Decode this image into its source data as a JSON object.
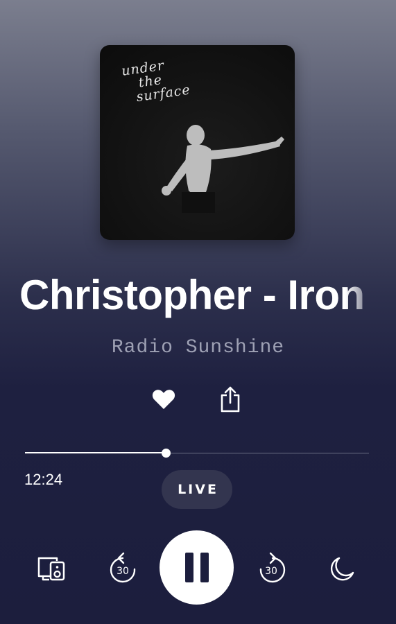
{
  "artwork": {
    "caption_line1": "under",
    "caption_line2": "the",
    "caption_line3": "surface"
  },
  "now_playing": {
    "title": "Christopher - Iron",
    "station": "Radio Sunshine"
  },
  "playback": {
    "elapsed": "12:24",
    "progress": 0.41,
    "live_label": "LIVE",
    "state": "playing",
    "skip_back_seconds": "30",
    "skip_forward_seconds": "30"
  },
  "icons": {
    "favorite": "heart-icon",
    "share": "share-icon",
    "devices": "speaker-devices-icon",
    "rewind": "rewind-30-icon",
    "pause": "pause-icon",
    "forward": "forward-30-icon",
    "sleep_timer": "moon-icon"
  },
  "colors": {
    "background_top": "#7b7e8e",
    "background_bottom": "#1c1e3d",
    "accent": "#ffffff",
    "secondary_text": "#9ea1b4",
    "live_badge": "#33354f"
  }
}
